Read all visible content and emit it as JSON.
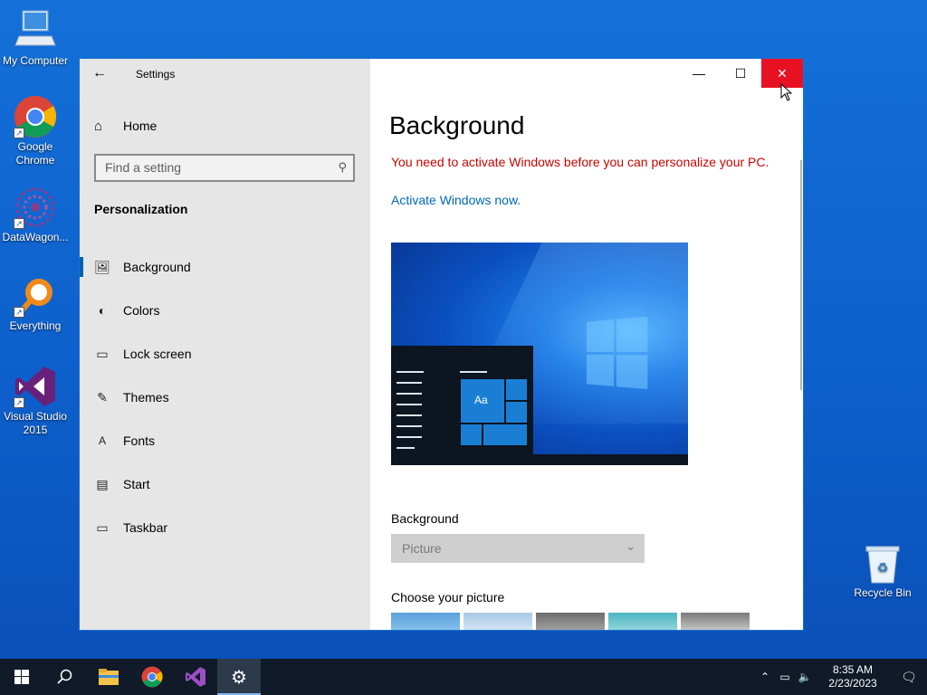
{
  "desktop": {
    "icons": [
      {
        "label": "My Computer",
        "icon": "computer-icon"
      },
      {
        "label": "Google Chrome",
        "icon": "chrome-icon"
      },
      {
        "label": "DataWagon...",
        "icon": "datawagon-icon"
      },
      {
        "label": "Everything",
        "icon": "everything-search-icon"
      },
      {
        "label": "Visual Studio 2015",
        "icon": "visual-studio-icon"
      },
      {
        "label": "Recycle Bin",
        "icon": "recycle-bin-icon"
      }
    ]
  },
  "window": {
    "app_title": "Settings",
    "controls": {
      "minimize": "—",
      "maximize": "☐",
      "close": "✕"
    },
    "sidebar": {
      "home_label": "Home",
      "search_placeholder": "Find a setting",
      "section_title": "Personalization",
      "items": [
        {
          "label": "Background",
          "icon": "picture-icon",
          "active": true
        },
        {
          "label": "Colors",
          "icon": "palette-icon",
          "active": false
        },
        {
          "label": "Lock screen",
          "icon": "lock-screen-icon",
          "active": false
        },
        {
          "label": "Themes",
          "icon": "themes-icon",
          "active": false
        },
        {
          "label": "Fonts",
          "icon": "fonts-icon",
          "active": false
        },
        {
          "label": "Start",
          "icon": "start-icon",
          "active": false
        },
        {
          "label": "Taskbar",
          "icon": "taskbar-icon",
          "active": false
        }
      ]
    },
    "main": {
      "title": "Background",
      "warning": "You need to activate Windows before you can personalize your PC.",
      "activate_link": "Activate Windows now.",
      "preview_tile_text": "Aa",
      "background_label": "Background",
      "background_value": "Picture",
      "choose_label": "Choose your picture"
    }
  },
  "taskbar": {
    "clock_time": "8:35 AM",
    "clock_date": "2/23/2023"
  },
  "colors": {
    "accent": "#0063b1",
    "warning": "#c50500",
    "link": "#0067b8",
    "close_hover": "#e81123"
  }
}
